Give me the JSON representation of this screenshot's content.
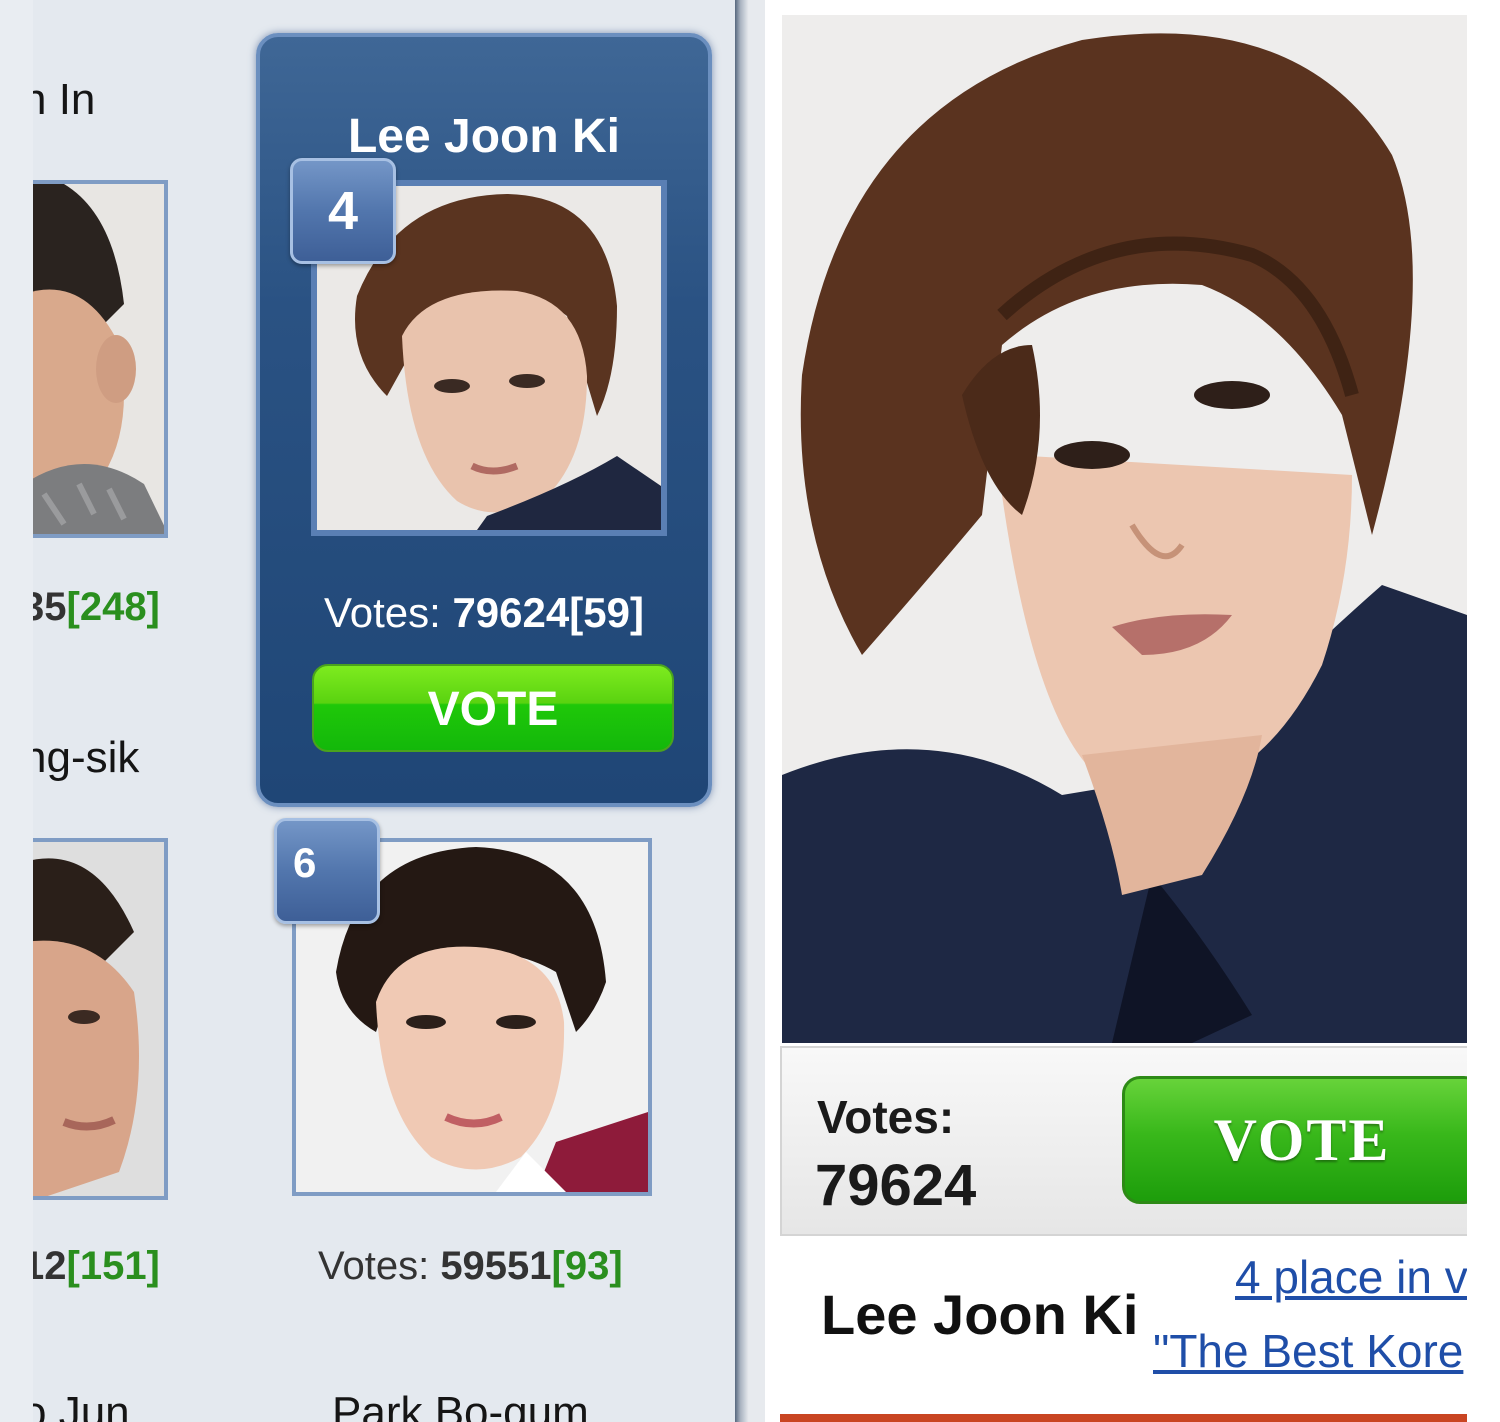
{
  "left": {
    "name_partial_1": "n In",
    "votes_partial_1": {
      "count": "35",
      "bracket": "[248]"
    },
    "name_partial_2": "ng-sik",
    "votes_partial_2": {
      "count": "12",
      "bracket": "[151]"
    },
    "name_partial_3": "o Jun",
    "card": {
      "name": "Lee Joon Ki",
      "rank": "4",
      "votes_label": "Votes: ",
      "votes_count": "79624",
      "votes_bracket": "[59]",
      "vote_button": "VOTE"
    },
    "second": {
      "rank": "6",
      "votes_label": "Votes: ",
      "votes_count": "59551",
      "votes_bracket": "[93]",
      "name": "Park Bo-gum"
    }
  },
  "right": {
    "votes_label": "Votes:",
    "votes_value": "79624",
    "vote_button": "VOTE",
    "name": "Lee Joon Ki",
    "link_line1": "4 place in v",
    "link_line2": "\"The Best Kore"
  },
  "colors": {
    "accent_blue": "#2a5283",
    "vote_green": "#1fc809",
    "bracket_green": "#2a8f1e",
    "link_blue": "#1f4ea8",
    "bottom_rule": "#c94522"
  }
}
